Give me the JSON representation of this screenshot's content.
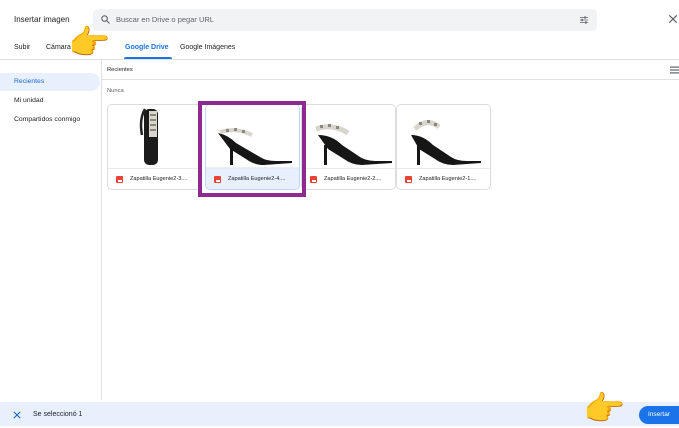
{
  "dialog": {
    "title": "Insertar imagen",
    "search_placeholder": "Buscar en Drive o pegar URL",
    "tabs": [
      {
        "label": "Subir"
      },
      {
        "label": "Cámara"
      },
      {
        "label": "Google Drive",
        "active": true
      },
      {
        "label": "Google Imágenes"
      }
    ]
  },
  "sidebar": {
    "items": [
      {
        "label": "Recientes",
        "active": true
      },
      {
        "label": "Mi unidad"
      },
      {
        "label": "Compartidos conmigo"
      }
    ]
  },
  "content": {
    "breadcrumb": "Recientes",
    "section_label": "Nunca",
    "files": [
      {
        "name": "Zapatilla Eugenie2-3....",
        "selected": false
      },
      {
        "name": "Zapatilla Eugenie2-4....",
        "selected": true
      },
      {
        "name": "Zapatilla Eugenie2-2....",
        "selected": false
      },
      {
        "name": "Zapatilla Eugenie2-1....",
        "selected": false
      }
    ]
  },
  "footer": {
    "selection_text": "Se seleccionó 1",
    "insert_label": "Insertar"
  },
  "colors": {
    "accent": "#1a73e8",
    "highlight_box": "#8e2a8f",
    "selection_bg": "#e8f0fe"
  },
  "icons": [
    "search-icon",
    "tune-icon",
    "close-icon",
    "list-view-icon",
    "image-file-icon",
    "pointing-hand-icon"
  ]
}
